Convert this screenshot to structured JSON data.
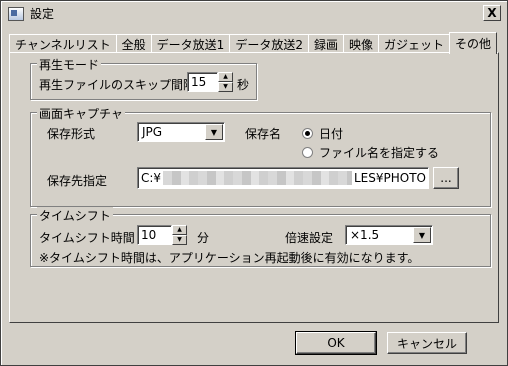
{
  "window": {
    "title": "設定",
    "close_label": "X"
  },
  "tabs": [
    {
      "label": "チャンネルリスト",
      "active": false
    },
    {
      "label": "全般",
      "active": false
    },
    {
      "label": "データ放送1",
      "active": false
    },
    {
      "label": "データ放送2",
      "active": false
    },
    {
      "label": "録画",
      "active": false
    },
    {
      "label": "映像",
      "active": false
    },
    {
      "label": "ガジェット",
      "active": false
    },
    {
      "label": "その他",
      "active": true
    }
  ],
  "playback": {
    "group_label": "再生モード",
    "skip_label": "再生ファイルのスキップ間隔",
    "skip_value": "15",
    "skip_unit": "秒"
  },
  "capture": {
    "group_label": "画面キャプチャ",
    "format_label": "保存形式",
    "format_value": "JPG",
    "name_label": "保存名",
    "radio_date": "日付",
    "radio_filename": "ファイル名を指定する",
    "dest_label": "保存先指定",
    "path_start": "C:¥",
    "path_end": "LES¥PHOTO",
    "browse_label": "..."
  },
  "timeshift": {
    "group_label": "タイムシフト",
    "time_label": "タイムシフト時間",
    "time_value": "10",
    "time_unit": "分",
    "speed_label": "倍速設定",
    "speed_value": "×1.5",
    "note": "※タイムシフト時間は、アプリケーション再起動後に有効になります。"
  },
  "buttons": {
    "ok": "OK",
    "cancel": "キャンセル"
  }
}
